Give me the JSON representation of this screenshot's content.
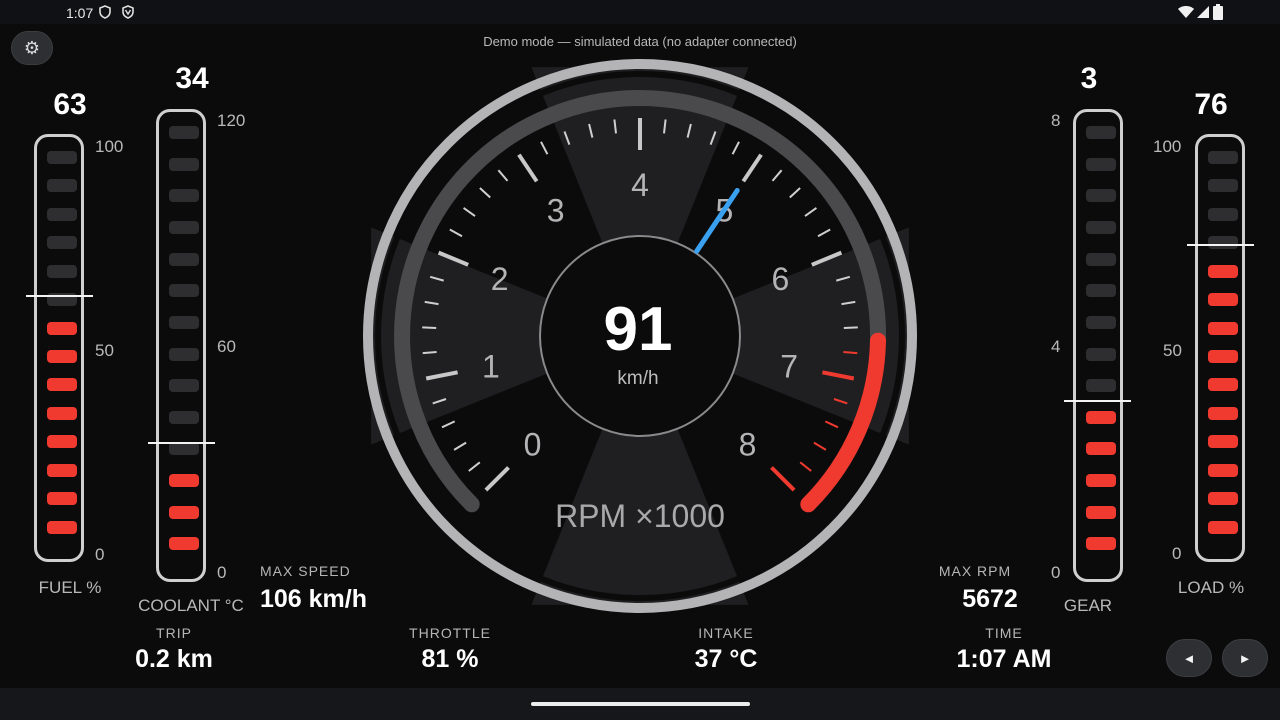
{
  "status_bar": {
    "time": "1:07",
    "icons": [
      "shield-icon",
      "vpn-shield-icon",
      "wifi-icon",
      "signal-icon",
      "battery-icon"
    ]
  },
  "demo_note": "Demo mode — simulated data (no adapter connected)",
  "settings_icon": "⚙",
  "gauge": {
    "speed": "91",
    "speed_unit": "km/h",
    "rpm_label": "RPM ×1000",
    "rpm_value": 5.0,
    "rpm_max": 8,
    "redline_start": 6.7,
    "tick_labels": [
      "0",
      "1",
      "2",
      "3",
      "4",
      "5",
      "6",
      "7",
      "8"
    ],
    "colors": {
      "needle": "#3aa0f0",
      "redline": "#f03a30"
    }
  },
  "bars": {
    "fuel": {
      "value": "63",
      "label": "FUEL %",
      "scale_top": "100",
      "scale_mid": "50",
      "scale_bottom": "0",
      "level": 0.63
    },
    "coolant": {
      "value": "34",
      "label": "COOLANT °C",
      "scale_top": "120",
      "scale_mid": "60",
      "scale_bottom": "0",
      "level": 0.28
    },
    "gear": {
      "value": "3",
      "label": "GEAR",
      "scale_top": "8",
      "scale_mid": "4",
      "scale_bottom": "0",
      "level": 0.375
    },
    "load": {
      "value": "76",
      "label": "LOAD %",
      "scale_top": "100",
      "scale_mid": "50",
      "scale_bottom": "0",
      "level": 0.76
    }
  },
  "stats": {
    "max_speed": {
      "label": "MAX SPEED",
      "value": "106 km/h"
    },
    "max_rpm": {
      "label": "MAX RPM",
      "value": "5672"
    },
    "trip": {
      "label": "TRIP",
      "value": "0.2 km"
    },
    "throttle": {
      "label": "THROTTLE",
      "value": "81 %"
    },
    "intake": {
      "label": "INTAKE",
      "value": "37 °C"
    },
    "time": {
      "label": "TIME",
      "value": "1:07 AM"
    }
  },
  "buttons": {
    "prev": "◄",
    "next": "►"
  }
}
